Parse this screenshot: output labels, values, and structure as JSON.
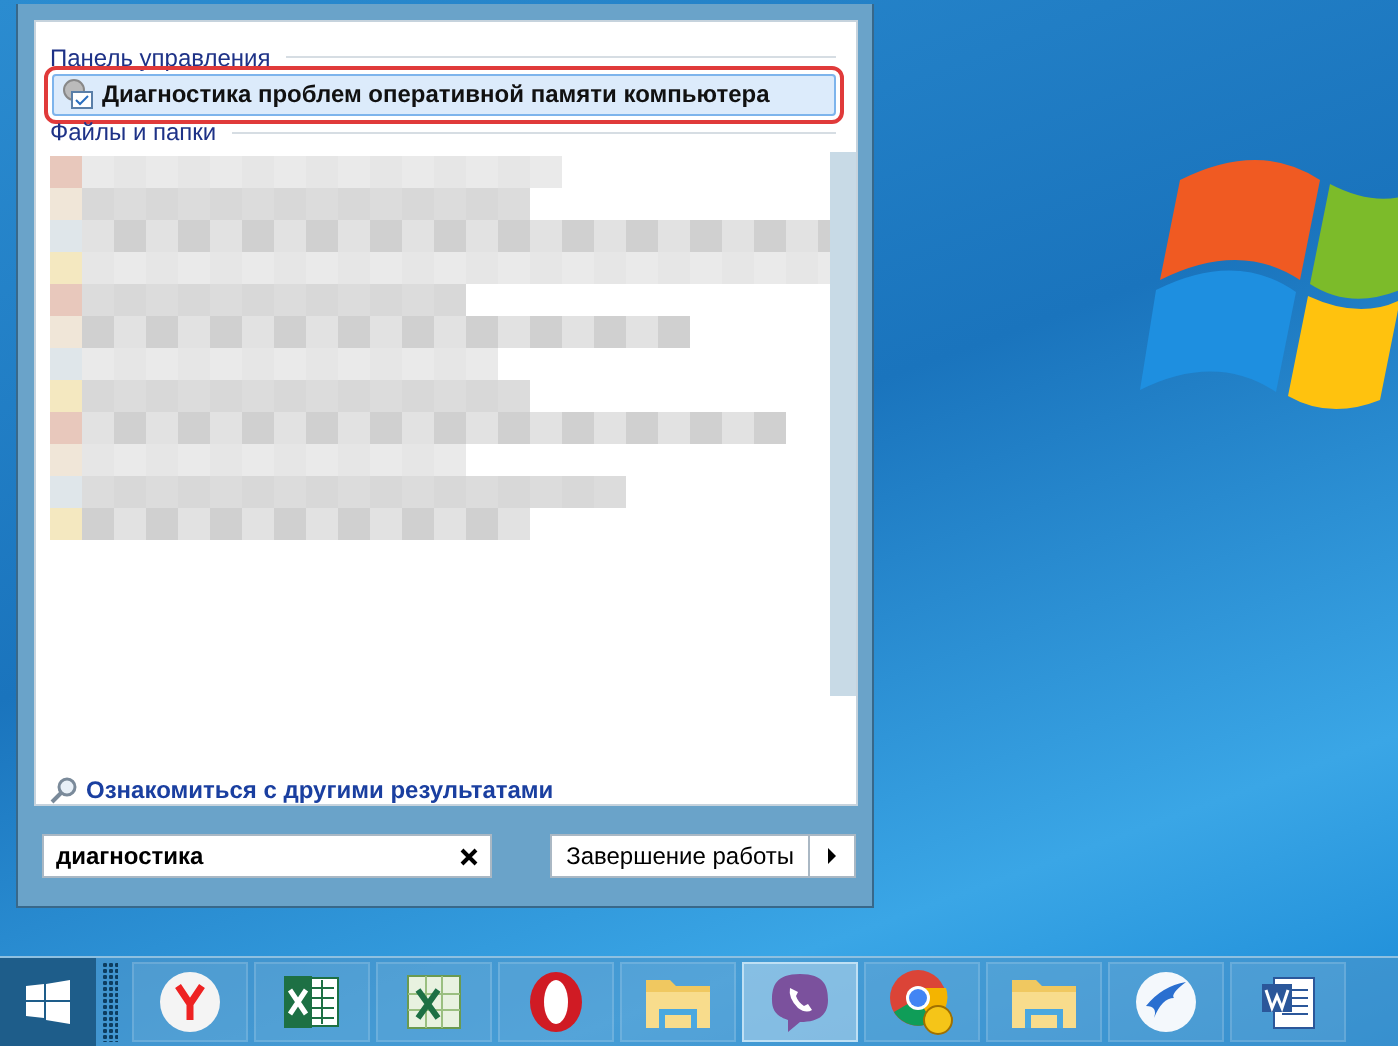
{
  "start_menu": {
    "sections": [
      {
        "title": "Панель управления",
        "items": [
          {
            "label": "Диагностика проблем оперативной памяти компьютера",
            "selected": true,
            "outlined": true
          }
        ]
      },
      {
        "title": "Файлы и папки"
      }
    ],
    "more_results": "Ознакомиться с другими результатами",
    "search": {
      "value": "диагностика"
    },
    "shutdown": {
      "label": "Завершение работы"
    }
  },
  "taskbar": [
    {
      "kind": "yandex",
      "active": false
    },
    {
      "kind": "excel",
      "active": false
    },
    {
      "kind": "spreadsheet",
      "active": false
    },
    {
      "kind": "opera",
      "active": false
    },
    {
      "kind": "folder",
      "active": false
    },
    {
      "kind": "viber",
      "active": true
    },
    {
      "kind": "chrome",
      "active": false
    },
    {
      "kind": "folder",
      "active": false
    },
    {
      "kind": "bird",
      "active": false
    },
    {
      "kind": "word",
      "active": false
    }
  ]
}
